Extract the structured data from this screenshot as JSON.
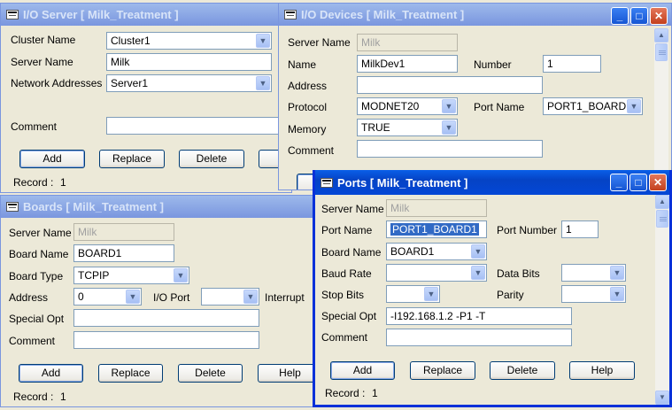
{
  "io_server": {
    "title": "I/O Server [ Milk_Treatment ]",
    "cluster_name_label": "Cluster Name",
    "cluster_name_value": "Cluster1",
    "server_name_label": "Server Name",
    "server_name_value": "Milk",
    "network_addresses_label": "Network Addresses",
    "network_addresses_value": "Server1",
    "comment_label": "Comment",
    "comment_value": "",
    "add_label": "Add",
    "replace_label": "Replace",
    "delete_label": "Delete",
    "record_label": "Record :",
    "record_value": "1"
  },
  "io_devices": {
    "title": "I/O Devices [ Milk_Treatment ]",
    "server_name_label": "Server Name",
    "server_name_value": "Milk",
    "name_label": "Name",
    "name_value": "MilkDev1",
    "number_label": "Number",
    "number_value": "1",
    "address_label": "Address",
    "address_value": "",
    "protocol_label": "Protocol",
    "protocol_value": "MODNET20",
    "port_name_label": "Port Name",
    "port_name_value": "PORT1_BOARD1",
    "memory_label": "Memory",
    "memory_value": "TRUE",
    "comment_label": "Comment",
    "comment_value": ""
  },
  "boards": {
    "title": "Boards [ Milk_Treatment ]",
    "server_name_label": "Server Name",
    "server_name_value": "Milk",
    "board_name_label": "Board Name",
    "board_name_value": "BOARD1",
    "board_type_label": "Board Type",
    "board_type_value": "TCPIP",
    "address_label": "Address",
    "address_value": "0",
    "io_port_label": "I/O Port",
    "io_port_value": "",
    "interrupt_label": "Interrupt",
    "special_opt_label": "Special Opt",
    "special_opt_value": "",
    "comment_label": "Comment",
    "comment_value": "",
    "add_label": "Add",
    "replace_label": "Replace",
    "delete_label": "Delete",
    "help_label": "Help",
    "record_label": "Record :",
    "record_value": "1"
  },
  "ports": {
    "title": "Ports [ Milk_Treatment ]",
    "server_name_label": "Server Name",
    "server_name_value": "Milk",
    "port_name_label": "Port Name",
    "port_name_value": "PORT1_BOARD1",
    "port_number_label": "Port Number",
    "port_number_value": "1",
    "board_name_label": "Board Name",
    "board_name_value": "BOARD1",
    "baud_rate_label": "Baud Rate",
    "baud_rate_value": "",
    "data_bits_label": "Data Bits",
    "data_bits_value": "",
    "stop_bits_label": "Stop Bits",
    "stop_bits_value": "",
    "parity_label": "Parity",
    "parity_value": "",
    "special_opt_label": "Special Opt",
    "special_opt_value": "-I192.168.1.2 -P1 -T",
    "comment_label": "Comment",
    "comment_value": "",
    "add_label": "Add",
    "replace_label": "Replace",
    "delete_label": "Delete",
    "help_label": "Help",
    "record_label": "Record :",
    "record_value": "1"
  },
  "window_controls": {
    "minimize": "_",
    "maximize": "□",
    "close": "✕"
  },
  "glyphs": {
    "dropdown": "▼",
    "scroll_up": "▲",
    "scroll_down": "▼"
  }
}
